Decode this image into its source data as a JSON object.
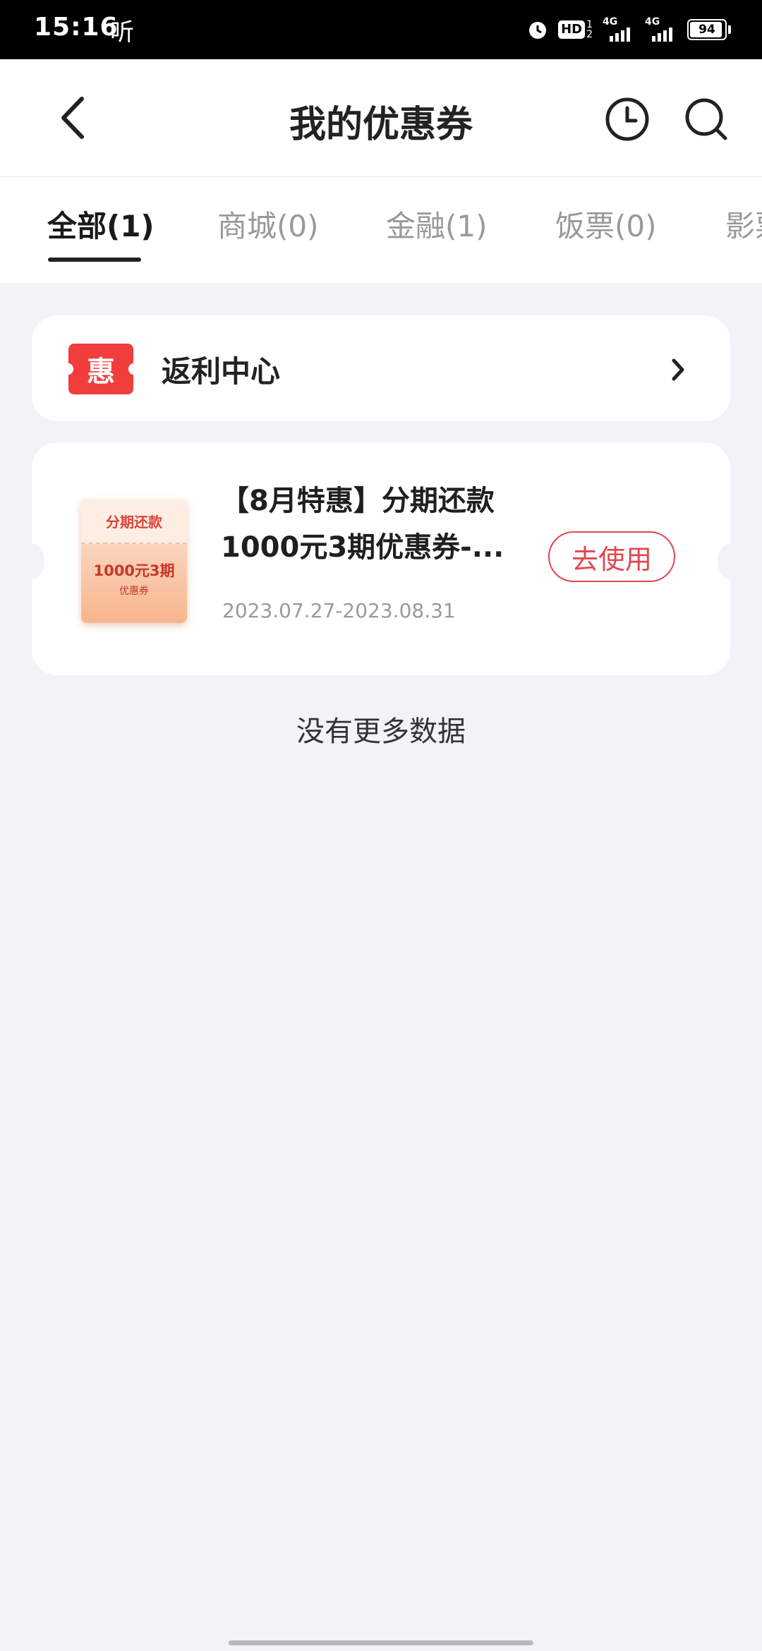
{
  "status_bar": {
    "time": "15:16",
    "listen_label": "听",
    "hd_label": "HD",
    "hd_sub_top": "1",
    "hd_sub_bottom": "2",
    "network_1": "4G",
    "network_2": "4G",
    "battery_level": "94",
    "battery_fraction": 0.94
  },
  "nav": {
    "title": "我的优惠券",
    "back_icon": "chevron-left-icon",
    "history_icon": "clock-icon",
    "search_icon": "search-icon"
  },
  "tabs": [
    {
      "label": "全部(1)",
      "active": true
    },
    {
      "label": "商城(0)",
      "active": false
    },
    {
      "label": "金融(1)",
      "active": false
    },
    {
      "label": "饭票(0)",
      "active": false
    },
    {
      "label": "影票",
      "active": false
    }
  ],
  "rebate": {
    "badge": "惠",
    "label": "返利中心",
    "arrow_icon": "chevron-right-icon"
  },
  "coupon": {
    "thumb_top": "分期还款",
    "thumb_amount": "1000元3期",
    "thumb_sub": "优惠券",
    "title": "【8月特惠】分期还款1000元3期优惠券-...",
    "date_range": "2023.07.27-2023.08.31",
    "action_label": "去使用"
  },
  "footer_text": "没有更多数据",
  "colors": {
    "accent": "#e0484f",
    "badge_red": "#f23d3d",
    "page_bg": "#f2f2f7"
  }
}
